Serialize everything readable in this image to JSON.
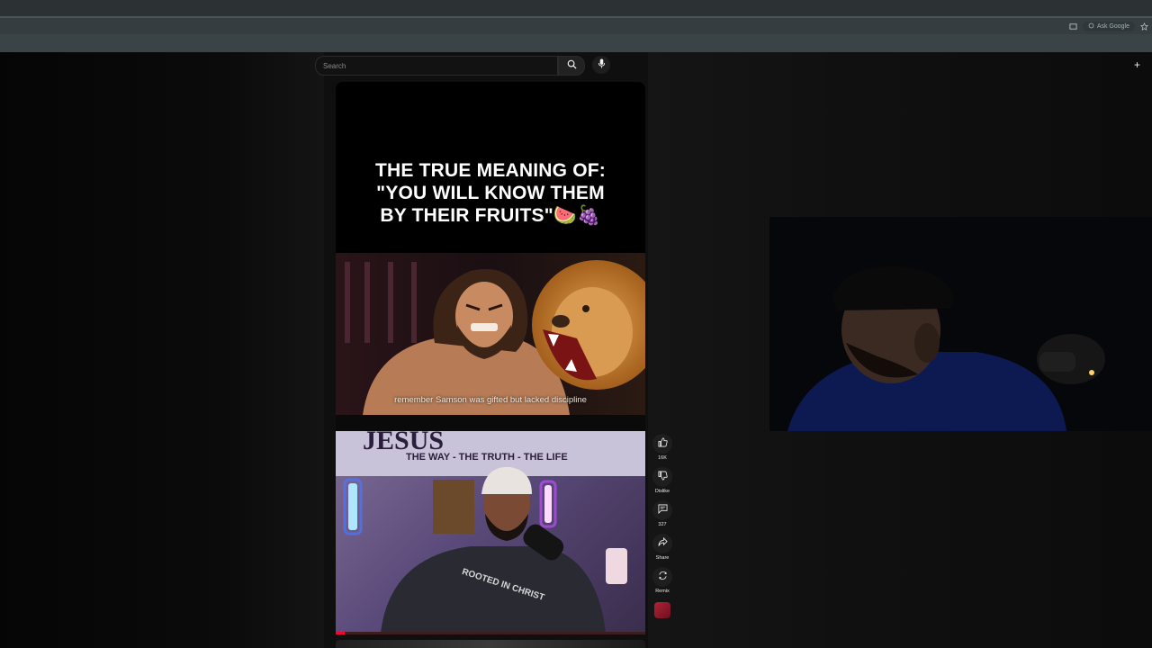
{
  "browser": {
    "ask_google_label": "Ask Google"
  },
  "search": {
    "placeholder": "Search"
  },
  "short": {
    "title_lines": [
      "THE TRUE MEANING OF:",
      "\"YOU WILL KNOW THEM",
      "BY THEIR FRUITS\"🍉🍇"
    ],
    "caption": "remember Samson was gifted but lacked discipline",
    "banner_line": "THE WAY - THE TRUTH - THE LIFE",
    "banner_word": "JESUS",
    "shirt_text": "ROOTED IN CHRIST",
    "progress_fraction": 0.03
  },
  "actions": {
    "like_count": "16K",
    "dislike_label": "Dislike",
    "comment_count": "327",
    "share_label": "Share",
    "remix_label": "Remix"
  },
  "colors": {
    "accent": "#ff0033",
    "page_background": "#0f0f0f"
  },
  "icons": [
    "search-icon",
    "mic-icon",
    "plus-icon",
    "thumbs-up-icon",
    "thumbs-down-icon",
    "comment-icon",
    "share-icon",
    "remix-icon",
    "star-icon"
  ]
}
